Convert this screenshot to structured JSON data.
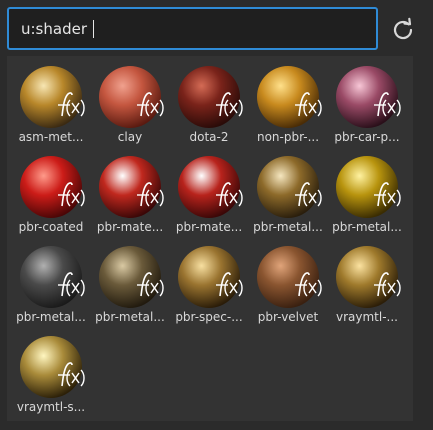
{
  "search": {
    "value": "u:shader"
  },
  "items": [
    {
      "label": "asm-met...",
      "material": "multi-gold-chrome"
    },
    {
      "label": "clay",
      "material": "clay"
    },
    {
      "label": "dota-2",
      "material": "dota"
    },
    {
      "label": "non-pbr-...",
      "material": "gold"
    },
    {
      "label": "pbr-car-p...",
      "material": "car-paint"
    },
    {
      "label": "pbr-coated",
      "material": "red-coated"
    },
    {
      "label": "pbr-mate...",
      "material": "red-chrome"
    },
    {
      "label": "pbr-mate...",
      "material": "red-chrome-2"
    },
    {
      "label": "pbr-metal...",
      "material": "metal-gold"
    },
    {
      "label": "pbr-metal...",
      "material": "gold-brushed"
    },
    {
      "label": "pbr-metal...",
      "material": "dark-metal"
    },
    {
      "label": "pbr-metal...",
      "material": "ring-metal"
    },
    {
      "label": "pbr-spec-...",
      "material": "spec-gold"
    },
    {
      "label": "pbr-velvet",
      "material": "velvet"
    },
    {
      "label": "vraymtl-...",
      "material": "vray-gold"
    },
    {
      "label": "vraymtl-s...",
      "material": "vray-silver-gold"
    }
  ]
}
